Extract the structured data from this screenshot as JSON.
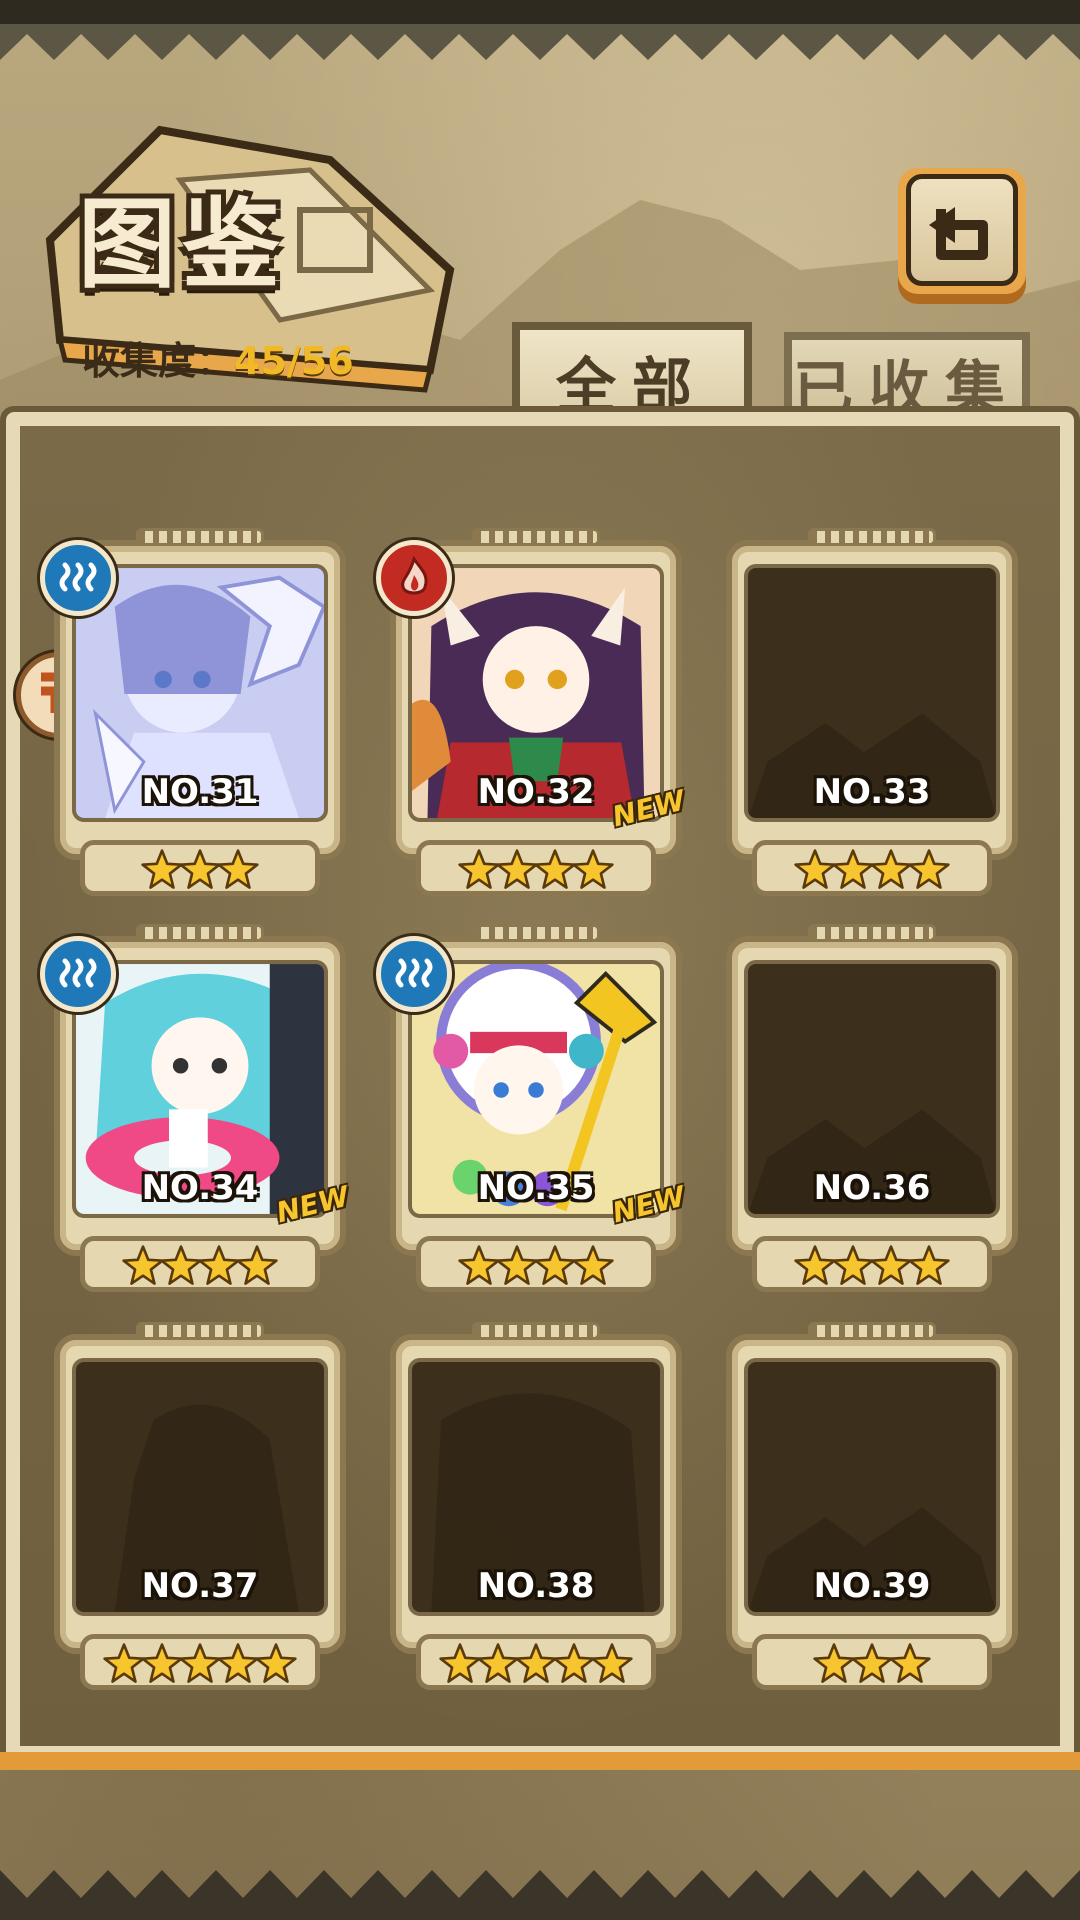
{
  "header": {
    "title": "图鉴",
    "collection_label": "收集度：",
    "collection_value": "45/56"
  },
  "tabs": [
    {
      "label": "全部",
      "active": true
    },
    {
      "label": "已收集",
      "active": false
    }
  ],
  "back_button": {
    "icon": "return-arrow-icon"
  },
  "cards": [
    {
      "number": "NO.31",
      "stars": 3,
      "element": "water",
      "new": false,
      "revealed": true,
      "portrait": "ice-crystal-girl"
    },
    {
      "number": "NO.32",
      "stars": 4,
      "element": "fire",
      "new": true,
      "new_label": "NEW",
      "revealed": true,
      "portrait": "fox-kimono-girl"
    },
    {
      "number": "NO.33",
      "stars": 4,
      "revealed": false
    },
    {
      "number": "NO.34",
      "stars": 4,
      "element": "water",
      "new": true,
      "new_label": "NEW",
      "revealed": true,
      "portrait": "swim-ring-girl"
    },
    {
      "number": "NO.35",
      "stars": 4,
      "element": "water",
      "new": true,
      "new_label": "NEW",
      "revealed": true,
      "portrait": "headdress-staff-girl"
    },
    {
      "number": "NO.36",
      "stars": 4,
      "revealed": false
    },
    {
      "number": "NO.37",
      "stars": 5,
      "revealed": false
    },
    {
      "number": "NO.38",
      "stars": 5,
      "revealed": false
    },
    {
      "number": "NO.39",
      "stars": 3,
      "revealed": false
    }
  ],
  "colors": {
    "star": "#f7c52d",
    "water_badge": "#1f79b8",
    "fire_badge": "#c22b22",
    "accent_orange": "#e39b3a"
  }
}
